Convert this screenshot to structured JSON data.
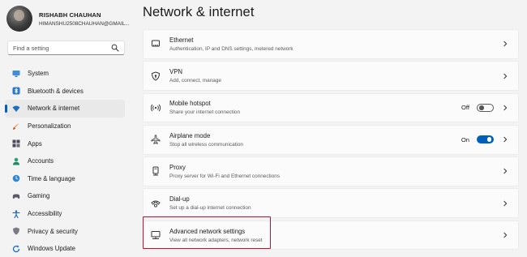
{
  "user": {
    "name": "RISHABH CHAUHAN",
    "email": "HIMANSHU2508CHAUHAN@GMAIL..."
  },
  "search": {
    "placeholder": "Find a setting",
    "icon": "search-icon"
  },
  "sidebar": {
    "items": [
      {
        "label": "System",
        "icon": "monitor-icon"
      },
      {
        "label": "Bluetooth & devices",
        "icon": "bluetooth-icon"
      },
      {
        "label": "Network & internet",
        "icon": "wifi-icon",
        "active": true
      },
      {
        "label": "Personalization",
        "icon": "brush-icon"
      },
      {
        "label": "Apps",
        "icon": "apps-grid-icon"
      },
      {
        "label": "Accounts",
        "icon": "person-icon"
      },
      {
        "label": "Time & language",
        "icon": "globe-clock-icon"
      },
      {
        "label": "Gaming",
        "icon": "gamepad-icon"
      },
      {
        "label": "Accessibility",
        "icon": "accessibility-icon"
      },
      {
        "label": "Privacy & security",
        "icon": "shield-icon"
      },
      {
        "label": "Windows Update",
        "icon": "refresh-icon"
      }
    ]
  },
  "main": {
    "title": "Network & internet",
    "cards": [
      {
        "title": "Ethernet",
        "desc": "Authentication, IP and DNS settings, metered network",
        "icon": "ethernet-icon"
      },
      {
        "title": "VPN",
        "desc": "Add, connect, manage",
        "icon": "vpn-shield-icon"
      },
      {
        "title": "Mobile hotspot",
        "desc": "Share your internet connection",
        "icon": "hotspot-icon",
        "toggle": "Off"
      },
      {
        "title": "Airplane mode",
        "desc": "Stop all wireless communication",
        "icon": "airplane-icon",
        "toggle": "On"
      },
      {
        "title": "Proxy",
        "desc": "Proxy server for Wi-Fi and Ethernet connections",
        "icon": "proxy-icon"
      },
      {
        "title": "Dial-up",
        "desc": "Set up a dial-up internet connection",
        "icon": "dialup-icon"
      },
      {
        "title": "Advanced network settings",
        "desc": "View all network adapters, network reset",
        "icon": "network-adapter-icon"
      }
    ]
  },
  "colors": {
    "accent": "#005fb8",
    "highlight_box": "#c8102e",
    "background": "#f3f3f3"
  }
}
